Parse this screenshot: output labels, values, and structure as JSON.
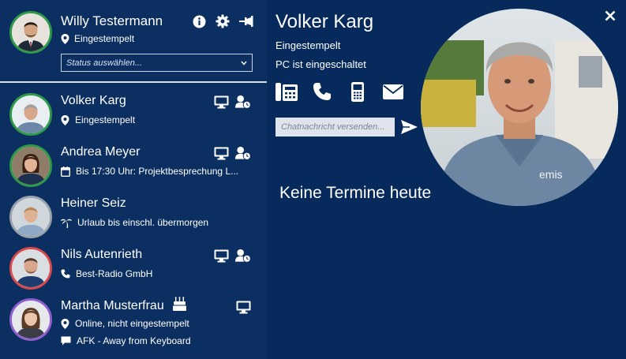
{
  "current_user": {
    "name": "Willy Testermann",
    "status": "Eingestempelt",
    "status_select_placeholder": "Status auswählen...",
    "ring_color": "#2e9a47"
  },
  "contacts": [
    {
      "name": "Volker Karg",
      "lines": [
        {
          "icon": "location-pin-icon",
          "text": "Eingestempelt"
        }
      ],
      "ring_color": "#2e9a47",
      "icons": [
        "monitor-icon",
        "user-clock-icon"
      ]
    },
    {
      "name": "Andrea Meyer",
      "lines": [
        {
          "icon": "calendar-icon",
          "text": "Bis 17:30 Uhr: Projektbesprechung L..."
        }
      ],
      "ring_color": "#2e9a47",
      "icons": [
        "monitor-icon",
        "user-clock-icon"
      ]
    },
    {
      "name": "Heiner Seiz",
      "lines": [
        {
          "icon": "palm-tree-icon",
          "text": "Urlaub bis einschl. übermorgen"
        }
      ],
      "ring_color": "#9aa3ad",
      "icons": []
    },
    {
      "name": "Nils Autenrieth",
      "lines": [
        {
          "icon": "phone-icon",
          "text": "Best-Radio GmbH"
        }
      ],
      "ring_color": "#d94a4a",
      "icons": [
        "monitor-icon",
        "user-clock-icon"
      ]
    },
    {
      "name": "Martha Musterfrau",
      "lines": [
        {
          "icon": "location-pin-icon",
          "text": "Online, nicht eingestempelt"
        },
        {
          "icon": "chat-bubble-icon",
          "text": "AFK - Away from Keyboard"
        }
      ],
      "ring_color": "#8f5fd0",
      "icons": [
        "monitor-icon"
      ],
      "badge": "birthday-cake-icon"
    }
  ],
  "detail": {
    "name": "Volker Karg",
    "status": "Eingestempelt",
    "pc_status": "PC ist eingeschaltet",
    "chat_placeholder": "Chatnachricht versenden...",
    "no_appointments": "Keine Termine heute"
  },
  "colors": {
    "background": "#072a5c",
    "panel": "#0c2f62",
    "text": "#ffffff",
    "ring_green": "#2e9a47",
    "ring_red": "#d94a4a",
    "ring_purple": "#8f5fd0",
    "ring_gray": "#9aa3ad"
  }
}
